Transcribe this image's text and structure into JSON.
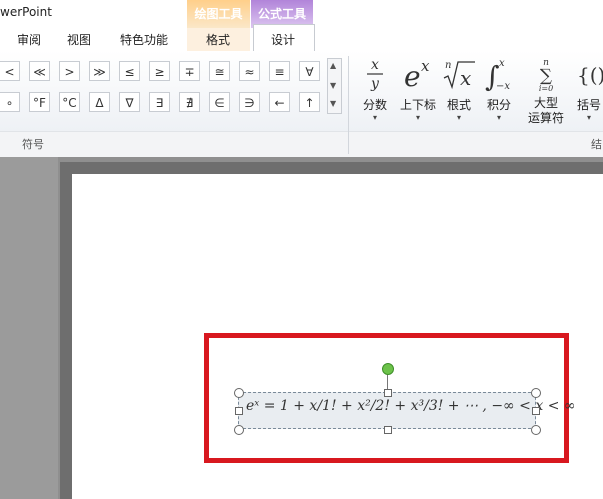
{
  "window": {
    "title": "werPoint"
  },
  "contextual": {
    "drawing_tools": "绘图工具",
    "equation_tools": "公式工具"
  },
  "tabs": {
    "review": "审阅",
    "view": "视图",
    "special": "特色功能",
    "format": "格式",
    "design": "设计"
  },
  "symbols": {
    "group_label": "符号",
    "row1": [
      "<",
      "≪",
      ">",
      "≫",
      "≤",
      "≥",
      "∓",
      "≅",
      "≈",
      "≡",
      "∀"
    ],
    "row2": [
      "∘",
      "°F",
      "°C",
      "Δ",
      "∇",
      "∃",
      "∄",
      "∈",
      "∋",
      "←",
      "↑"
    ]
  },
  "structures": {
    "group_label": "结",
    "items": [
      {
        "label": "分数",
        "icon": "fraction-icon"
      },
      {
        "label": "上下标",
        "icon": "script-icon"
      },
      {
        "label": "根式",
        "icon": "radical-icon"
      },
      {
        "label": "积分",
        "icon": "integral-icon"
      },
      {
        "label": "大型\n运算符",
        "icon": "large-operator-icon"
      },
      {
        "label": "括号",
        "icon": "bracket-icon"
      }
    ]
  },
  "slide": {
    "equation": "eˣ = 1 + x/1! + x²/2! + x³/3! + ⋯ ,     −∞ < x < ∞"
  },
  "colors": {
    "highlight": "#d8181f",
    "equation_tools": "#9b6fc8",
    "drawing_tools": "#f4a640"
  }
}
